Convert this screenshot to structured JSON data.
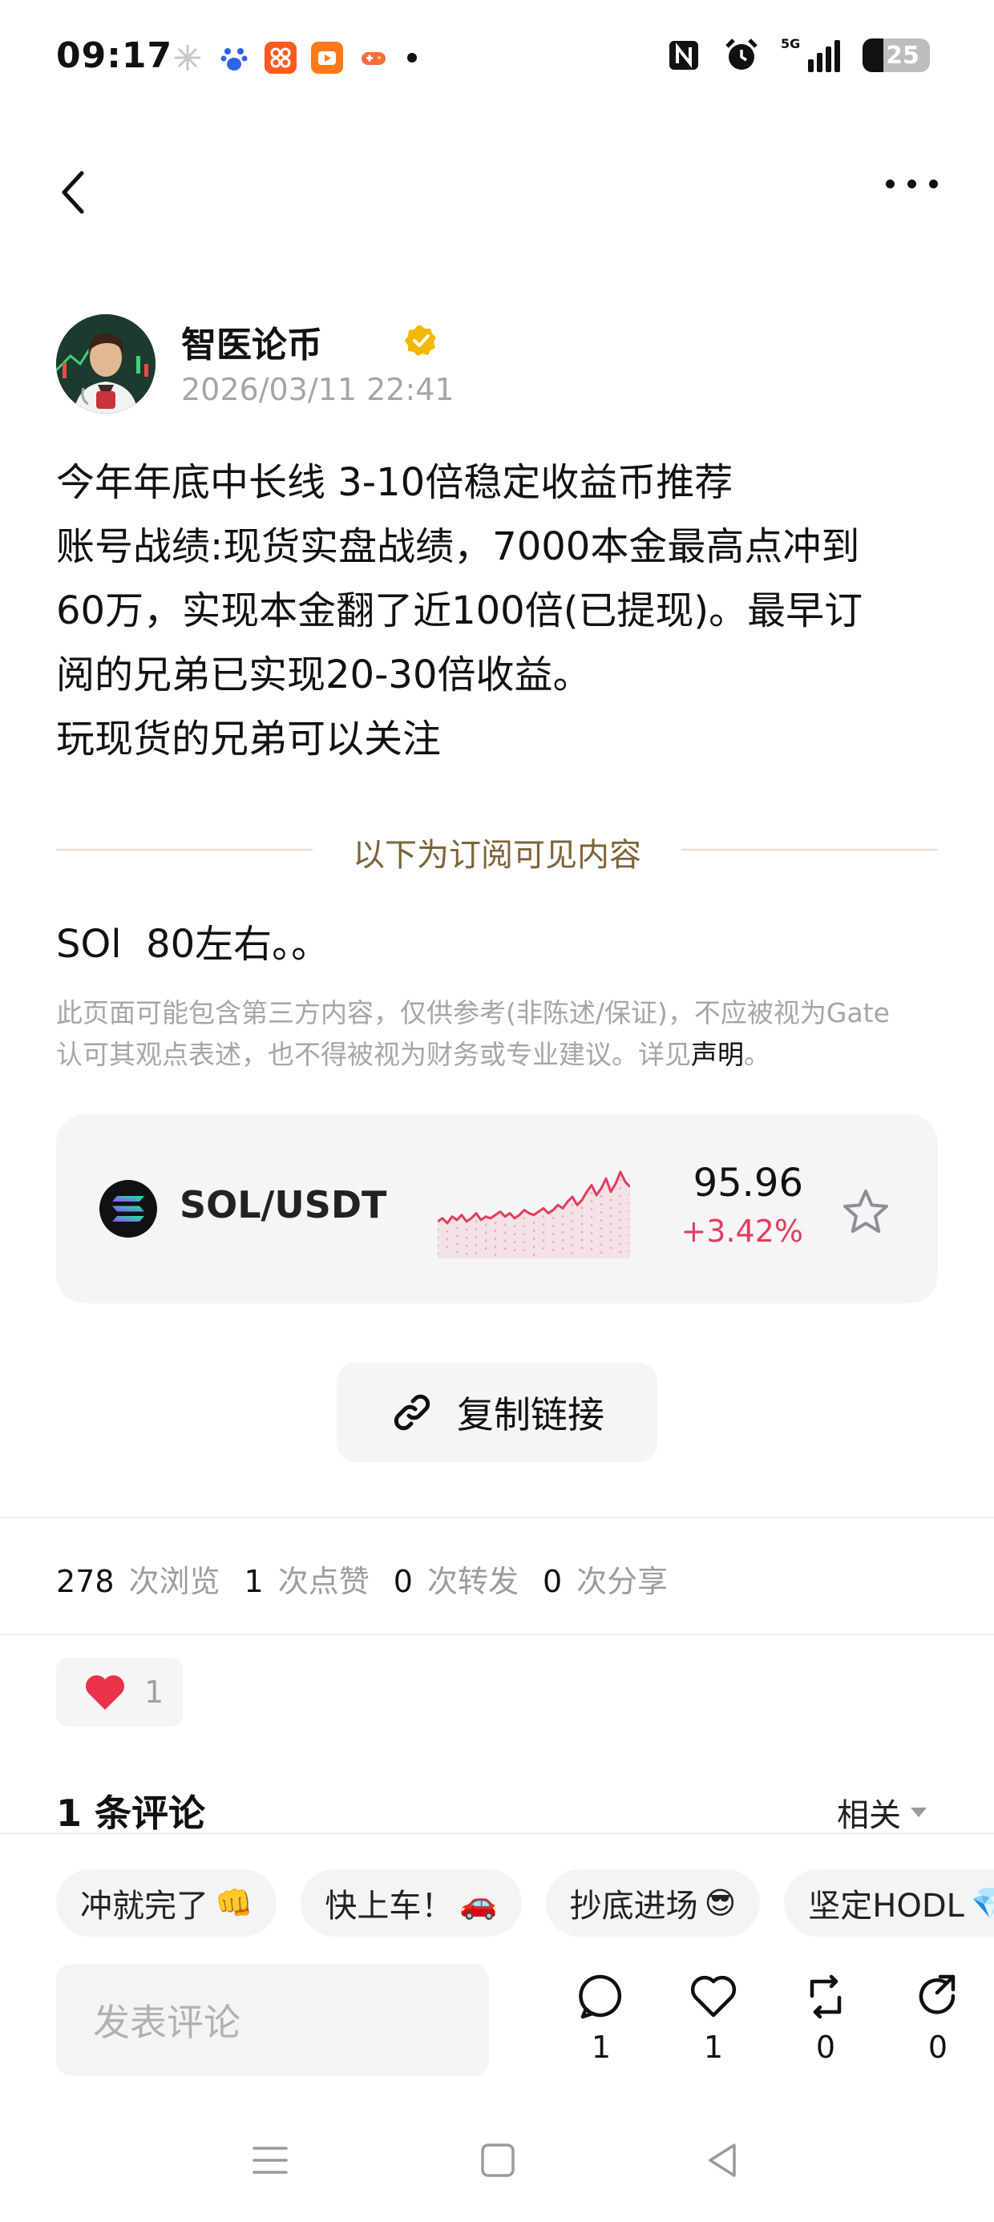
{
  "status_bar": {
    "time": "09:17",
    "battery": "25",
    "network": "5G",
    "icons": [
      "pinwheel-icon",
      "baidu-icon",
      "taobao-icon",
      "video-app-icon",
      "game-app-icon",
      "nfc-icon",
      "alarm-icon",
      "signal-icon",
      "battery-icon"
    ]
  },
  "author": {
    "name": "智医论币",
    "time": "2026/03/11 22:41"
  },
  "post": {
    "lines": [
      "今年年底中长线 3-10倍稳定收益币推荐",
      "账号战绩:现货实盘战绩，7000本金最高点冲到",
      "60万，实现本金翻了近100倍(已提现)。最早订",
      "阅的兄弟已实现20-30倍收益。",
      "玩现货的兄弟可以关注"
    ],
    "subscriber_divider": "以下为订阅可见内容",
    "sol_note": "SOl  80左右。。",
    "disclaimer_line1": "此页面可能包含第三方内容，仅供参考(非陈述/保证)，不应被视为Gate",
    "disclaimer_line2": "认可其观点表述，也不得被视为财务或专业建议。详见",
    "disclaimer_link": "声明",
    "disclaimer_end": "。"
  },
  "ticker": {
    "pair": "SOL/USDT",
    "price": "95.96",
    "change": "+3.42%",
    "spark_values": [
      40,
      42,
      39,
      43,
      41,
      44,
      40,
      42,
      45,
      41,
      43,
      42,
      44,
      46,
      43,
      45,
      42,
      44,
      47,
      45,
      44,
      46,
      48,
      45,
      47,
      50,
      48,
      52,
      55,
      50,
      53,
      58,
      62,
      56,
      60,
      66,
      58,
      63,
      70,
      64,
      61
    ]
  },
  "copy_link": "复制链接",
  "stats": {
    "views": "278",
    "views_label": "次浏览",
    "likes": "1",
    "likes_label": "次点赞",
    "reposts": "0",
    "reposts_label": "次转发",
    "shares": "0",
    "shares_label": "次分享"
  },
  "like_chip_count": "1",
  "comments": {
    "header": "1 条评论",
    "sort": "相关"
  },
  "quick_replies": [
    {
      "text": "冲就完了",
      "emoji": "👊"
    },
    {
      "text": "快上车！",
      "emoji": "🚗"
    },
    {
      "text": "抄底进场",
      "emoji": "😎"
    },
    {
      "text": "坚定HODL",
      "emoji": "💎"
    }
  ],
  "comment_input_placeholder": "发表评论",
  "actions": {
    "comment_count": "1",
    "like_count": "1",
    "repost_count": "0",
    "share_count": "0"
  },
  "colors": {
    "price_up": "#e23d5c",
    "verified": "#f5b800",
    "divider_text": "#7d6439"
  }
}
